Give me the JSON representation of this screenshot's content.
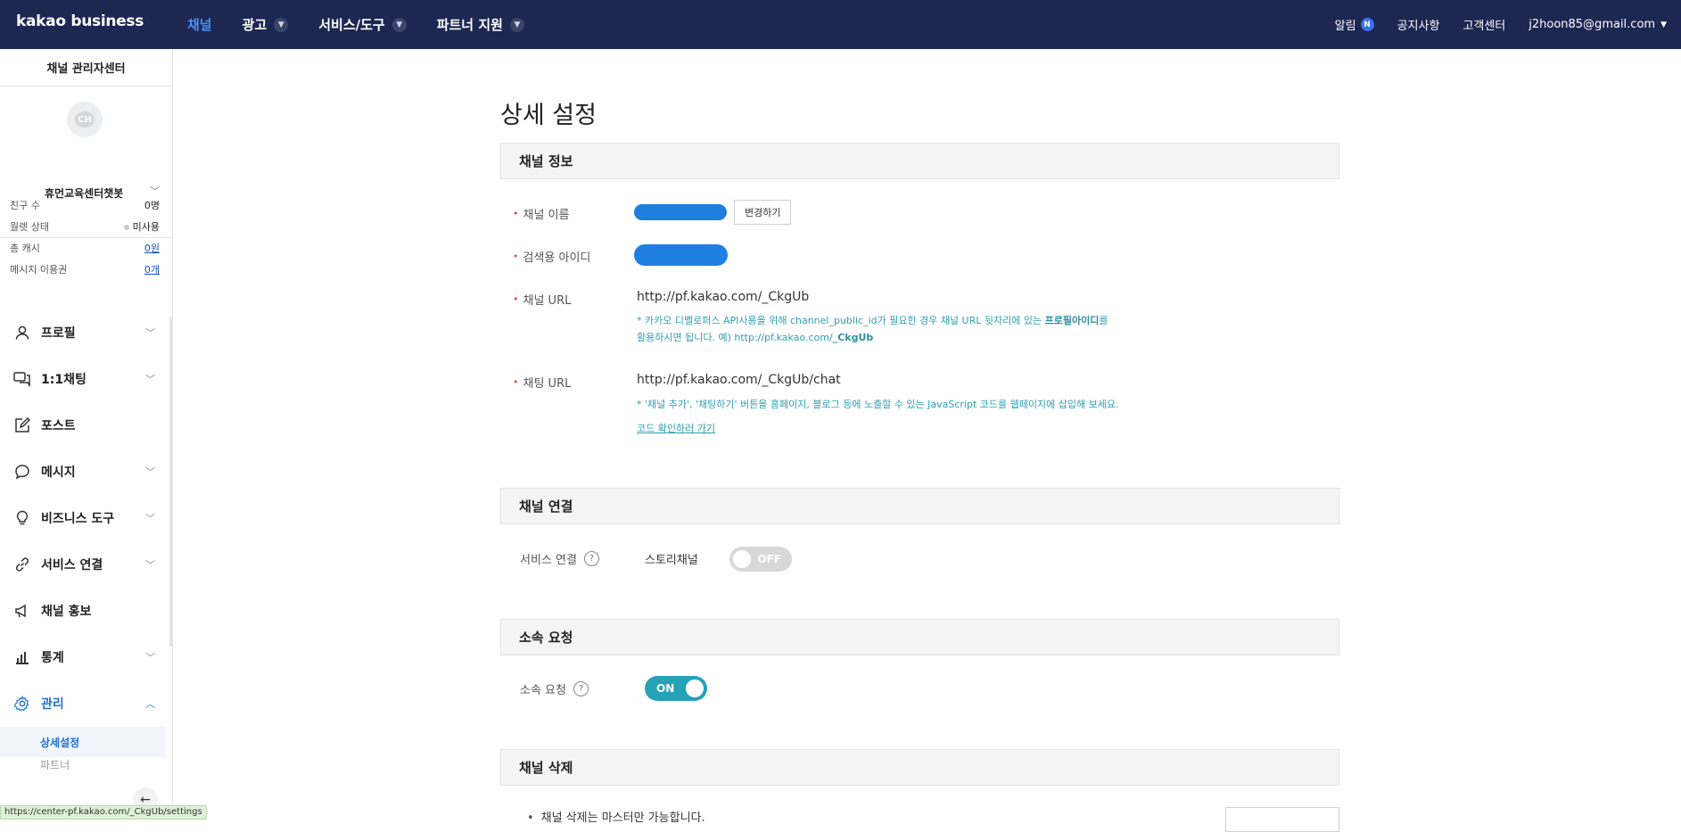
{
  "header": {
    "brand": "kakao business",
    "nav": [
      {
        "label": "채널",
        "active": true,
        "has_dropdown": false
      },
      {
        "label": "광고",
        "active": false,
        "has_dropdown": true
      },
      {
        "label": "서비스/도구",
        "active": false,
        "has_dropdown": true
      },
      {
        "label": "파트너 지원",
        "active": false,
        "has_dropdown": true
      }
    ],
    "alerts_label": "알림",
    "alerts_badge": "N",
    "notice_label": "공지사항",
    "support_label": "고객센터",
    "account_email": "j2hoon85@gmail.com"
  },
  "sidebar": {
    "title": "채널 관리자센터",
    "avatar_text": "CH",
    "channel_name": "휴먼교육센터챗봇",
    "stats": [
      {
        "label": "친구 수",
        "value": "0명"
      },
      {
        "label": "월렛 상태",
        "value": "미사용"
      },
      {
        "label": "총 캐시",
        "value": "0원"
      },
      {
        "label": "메시지 이용권",
        "value": "0개"
      }
    ],
    "menu": [
      {
        "label": "프로필",
        "icon": "person-icon"
      },
      {
        "label": "1:1채팅",
        "icon": "chat-icon"
      },
      {
        "label": "포스트",
        "icon": "edit-icon"
      },
      {
        "label": "메시지",
        "icon": "speech-bubble-icon"
      },
      {
        "label": "비즈니스 도구",
        "icon": "lightbulb-icon"
      },
      {
        "label": "서비스 연결",
        "icon": "link-icon"
      },
      {
        "label": "채널 홍보",
        "icon": "megaphone-icon"
      },
      {
        "label": "통계",
        "icon": "bar-chart-icon"
      },
      {
        "label": "관리",
        "icon": "gear-icon"
      }
    ],
    "submenu_active": "상세설정",
    "submenu_next": "파트너",
    "status_url": "https://center-pf.kakao.com/_CkgUb/settings"
  },
  "main": {
    "page_title": "상세 설정",
    "channel_info": {
      "heading": "채널 정보",
      "name_label": "채널 이름",
      "change_button": "변경하기",
      "search_id_label": "검색용 아이디",
      "url_label": "채널 URL",
      "url_value": "http://pf.kakao.com/_CkgUb",
      "url_note_1": "* 카카오 디벨로퍼스 API사용을 위해 channel_public_id가 필요한 경우 채널 URL 뒷자리에 있는 ",
      "url_note_bold": "프로필아이디",
      "url_note_2": "를",
      "url_note_line2": "활용하시면 됩니다. 예) http://pf.kakao.com/",
      "url_note_line2_bold": "_CkgUb",
      "chat_url_label": "채팅 URL",
      "chat_url_value": "http://pf.kakao.com/_CkgUb/chat",
      "chat_note": "* '채널 추가', '채팅하기' 버튼을 홈페이지, 블로그 등에 노출할 수 있는 JavaScript 코드를 웹페이지에 삽입해 보세요.",
      "code_link": "코드 확인하러 가기"
    },
    "channel_link": {
      "heading": "채널 연결",
      "service_label": "서비스 연결",
      "story_label": "스토리채널",
      "toggle": "OFF"
    },
    "affiliation": {
      "heading": "소속 요청",
      "label": "소속 요청",
      "toggle": "ON"
    },
    "delete": {
      "heading": "채널 삭제",
      "note": "채널 삭제는 마스터만 가능합니다."
    }
  }
}
